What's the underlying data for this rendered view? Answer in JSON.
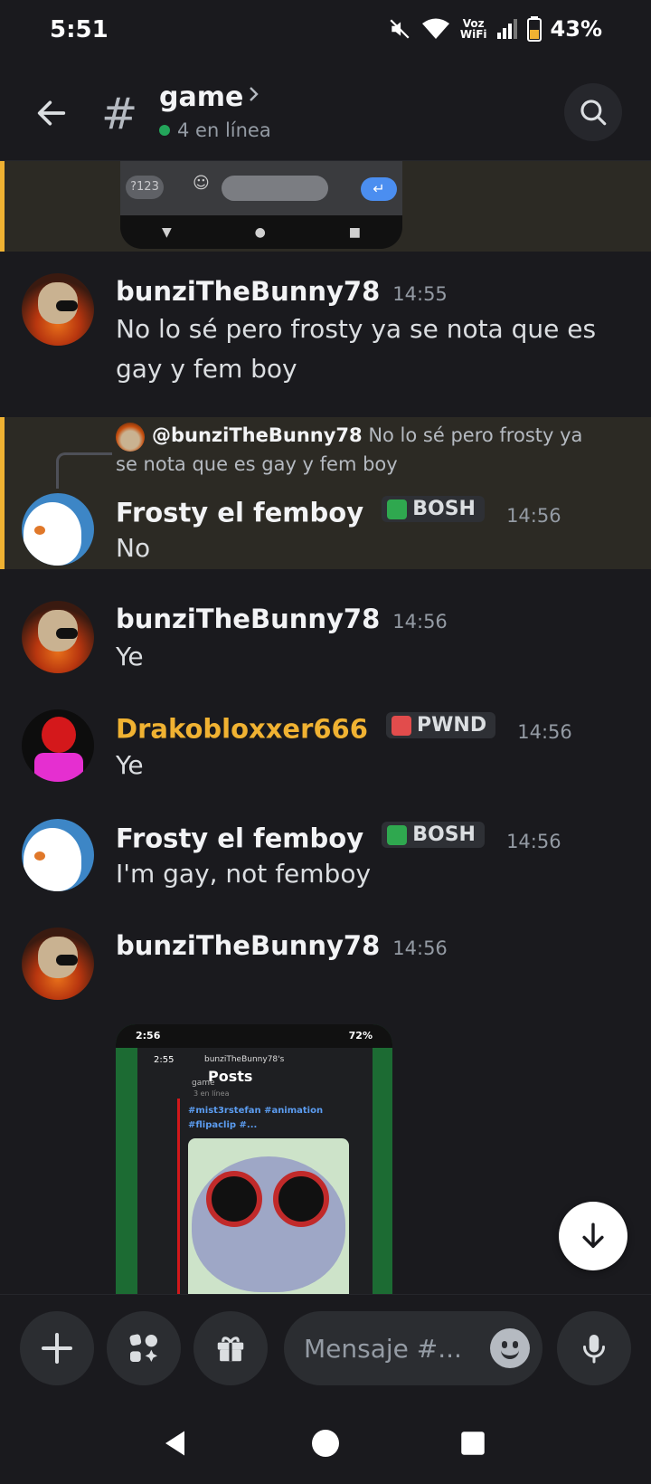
{
  "status": {
    "time": "5:51",
    "volte_top": "Voz",
    "volte_bottom": "WiFi",
    "battery": "43%"
  },
  "header": {
    "channel_name": "game",
    "online_text": "4 en línea"
  },
  "top_embed": {
    "key_123": "?123"
  },
  "messages": [
    {
      "author": "bunziTheBunny78",
      "time": "14:55",
      "text": "No lo sé pero frosty ya se nota que es gay y fem boy"
    },
    {
      "reply_user": "@bunziTheBunny78",
      "reply_text": "No lo sé pero frosty ya se nota que es gay y fem boy",
      "author": "Frosty el femboy",
      "tag": "BOSH",
      "time": "14:56",
      "text": "No"
    },
    {
      "author": "bunziTheBunny78",
      "time": "14:56",
      "text": "Ye"
    },
    {
      "author": "Drakobloxxer666",
      "tag": "PWND",
      "time": "14:56",
      "text": "Ye"
    },
    {
      "author": "Frosty el femboy",
      "tag": "BOSH",
      "time": "14:56",
      "text": "I'm gay, not femboy"
    },
    {
      "author": "bunziTheBunny78",
      "time": "14:56",
      "attachment": {
        "status_time": "2:56",
        "status_battery": "72%",
        "inner_time": "2:55",
        "inner_user": "bunziTheBunny78's",
        "inner_title": "Posts",
        "inner_channel": "game",
        "inner_online": "3 en línea",
        "tags": "#mist3rstefan #animation #flipaclip #..."
      }
    }
  ],
  "composer": {
    "placeholder": "Mensaje #..."
  },
  "colors": {
    "accent_yellow": "#f0b232",
    "online_green": "#23a55a",
    "highlight_bg": "#2c2a24",
    "background": "#1a1a1e"
  }
}
